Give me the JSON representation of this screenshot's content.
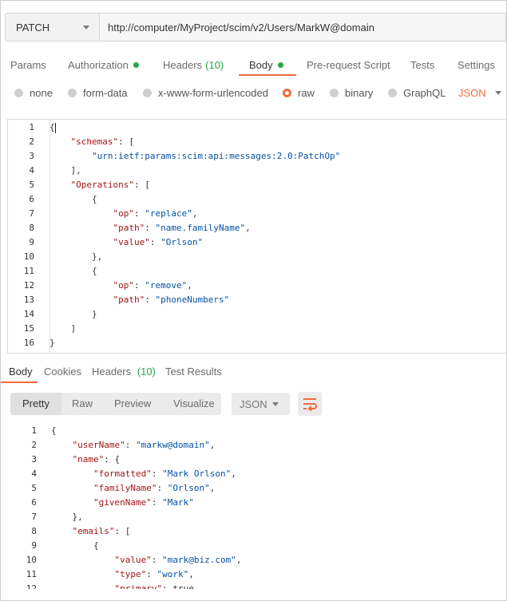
{
  "request": {
    "method": "PATCH",
    "url": "http://computer/MyProject/scim/v2/Users/MarkW@domain"
  },
  "request_tabs": [
    {
      "label": "Params"
    },
    {
      "label": "Authorization",
      "dot": true
    },
    {
      "label": "Headers",
      "count": "(10)"
    },
    {
      "label": "Body",
      "dot": true,
      "active": true
    },
    {
      "label": "Pre-request Script"
    },
    {
      "label": "Tests"
    },
    {
      "label": "Settings"
    }
  ],
  "body_types": {
    "options": [
      "none",
      "form-data",
      "x-www-form-urlencoded",
      "raw",
      "binary",
      "GraphQL"
    ],
    "selected": "raw",
    "format": "JSON"
  },
  "request_body": [
    "{",
    "    \"schemas\": [",
    "        \"urn:ietf:params:scim:api:messages:2.0:PatchOp\"",
    "    ],",
    "    \"Operations\": [",
    "        {",
    "            \"op\": \"replace\",",
    "            \"path\": \"name.familyName\",",
    "            \"value\": \"Orlson\"",
    "        },",
    "        {",
    "            \"op\": \"remove\",",
    "            \"path\": \"phoneNumbers\"",
    "        }",
    "    ]",
    "}"
  ],
  "response_tabs": [
    {
      "label": "Body",
      "active": true
    },
    {
      "label": "Cookies"
    },
    {
      "label": "Headers",
      "count": "(10)"
    },
    {
      "label": "Test Results"
    }
  ],
  "response_view": {
    "modes": [
      "Pretty",
      "Raw",
      "Preview",
      "Visualize"
    ],
    "active_mode": "Pretty",
    "format": "JSON"
  },
  "response_body": [
    "{",
    "    \"userName\": \"markw@domain\",",
    "    \"name\": {",
    "        \"formatted\": \"Mark Orlson\",",
    "        \"familyName\": \"Orlson\",",
    "        \"givenName\": \"Mark\"",
    "    },",
    "    \"emails\": [",
    "        {",
    "            \"value\": \"mark@biz.com\",",
    "            \"type\": \"work\",",
    "            \"primary\": true"
  ],
  "colors": {
    "accent": "#f26b3a",
    "indicator": "#26a745",
    "json_key": "#a31515",
    "json_string": "#0451a5"
  },
  "icons": {
    "method_dropdown": "chevron-down-icon",
    "format_dropdown": "chevron-down-icon",
    "wrap": "wrap-lines-icon"
  }
}
